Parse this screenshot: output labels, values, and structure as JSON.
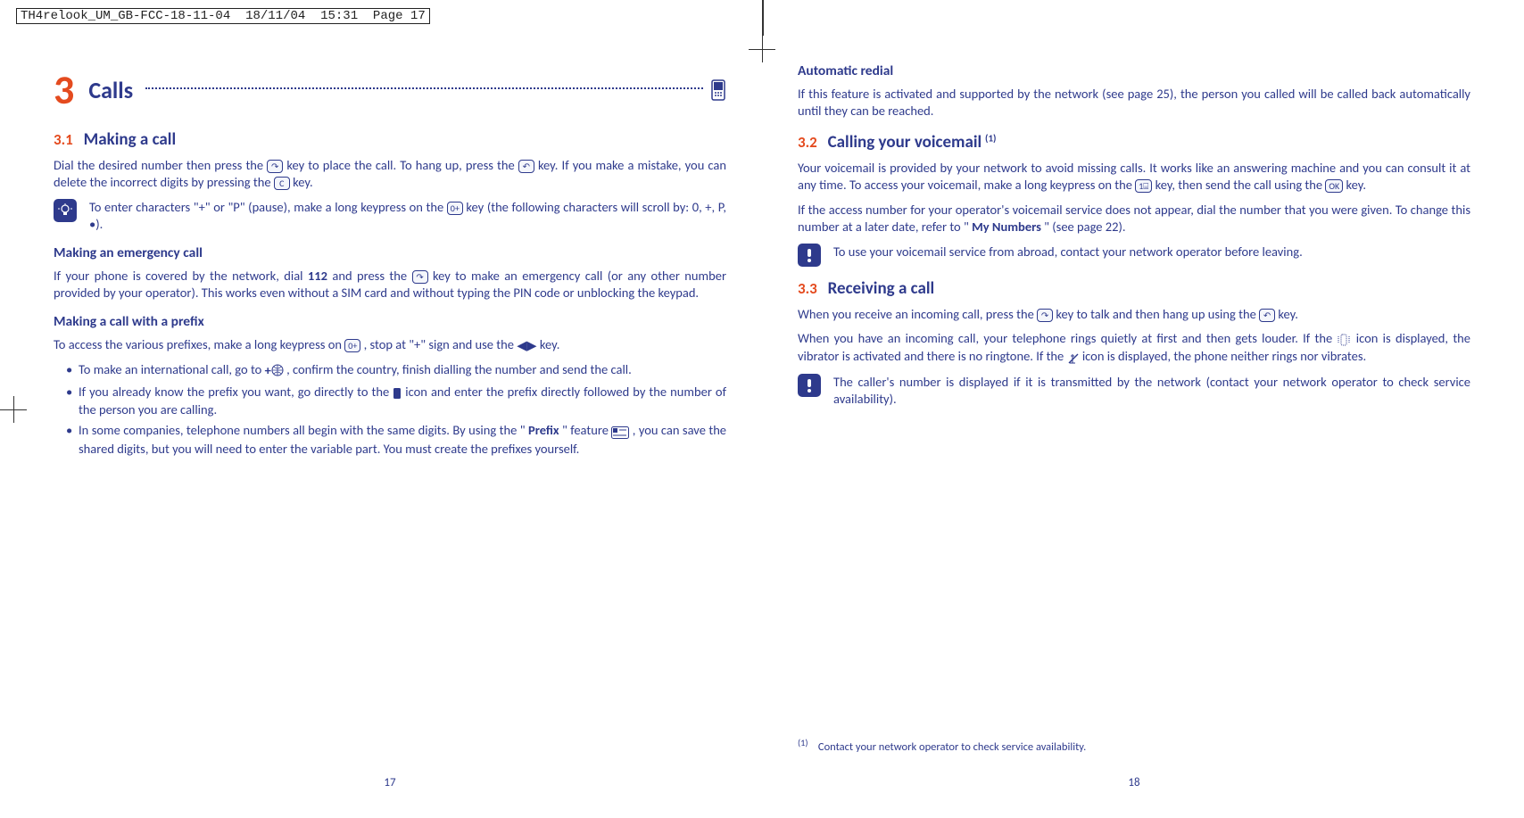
{
  "print_header": {
    "filename": "TH4relook_UM_GB-FCC-18-11-04",
    "date": "18/11/04",
    "time": "15:31",
    "page_label": "Page 17"
  },
  "left_page": {
    "chapter_number": "3",
    "chapter_title": "Calls",
    "page_number": "17",
    "sec31": {
      "num": "3.1",
      "title": "Making a call",
      "p1a": "Dial the desired number then press the ",
      "p1b": " key to place the call. To hang up, press the ",
      "p1c": " key. If you make a mistake, you can delete the incorrect digits by pressing the ",
      "p1d": " key.",
      "tip1a": "To enter characters \"+\" or \"P\" (pause), make a long keypress on the ",
      "tip1b": " key (the following characters will scroll by: 0, +, P, •).",
      "emergency_head": "Making an emergency call",
      "emergency_a": "If your phone is covered by the network, dial ",
      "emergency_num": "112",
      "emergency_b": " and press the ",
      "emergency_c": " key to make an emergency call (or any other number provided by your operator). This works even without a SIM card and without typing the PIN code or unblocking the keypad.",
      "prefix_head": "Making a call with a prefix",
      "prefix_p_a": "To access the various prefixes, make a long keypress on ",
      "prefix_p_b": ", stop at \"+\" sign and use the ",
      "prefix_p_c": " key.",
      "li1a": "To make an international call, go to ",
      "li1b": " , confirm the country, finish dialling the number and send the call.",
      "li2a": "If you already know the prefix you want, go directly to the ",
      "li2b": " icon and enter the prefix directly followed by the number of the person you are calling.",
      "li3a": "In some companies, telephone numbers all begin with the same digits. By using the \"",
      "li3_bold": "Prefix",
      "li3b": "\" feature ",
      "li3c": " , you can save the shared digits, but you will need to enter the variable part. You must create the prefixes yourself."
    }
  },
  "right_page": {
    "page_number": "18",
    "auto_redial_head": "Automatic redial",
    "auto_redial_body": "If this feature is activated and supported by the network (see page 25), the person you called will be called back automatically until they can be reached.",
    "sec32": {
      "num": "3.2",
      "title": "Calling your voicemail",
      "sup": "(1)",
      "p1a": "Your voicemail is provided by your network to avoid missing calls. It works like an answering machine and you can consult it at any time. To access your voicemail, make a long keypress on the ",
      "p1b": " key, then send the call using the ",
      "p1c": " key.",
      "p2a": "If the access number for your operator's voicemail service does not appear, dial the number that you were given. To change this number at a later date, refer to \"",
      "p2_bold": "My Numbers",
      "p2b": "\" (see page 22).",
      "warn": "To use your voicemail service from abroad, contact your network operator before leaving."
    },
    "sec33": {
      "num": "3.3",
      "title": "Receiving a call",
      "p1a": "When you receive an incoming call, press the ",
      "p1b": " key to talk and then hang up using the ",
      "p1c": " key.",
      "p2a": "When you have an incoming call, your telephone rings quietly at first and then gets louder. If the ",
      "p2b": " icon is displayed, the vibrator is activated and there is no ringtone. If the ",
      "p2c": " icon is displayed, the phone neither rings nor vibrates.",
      "warn": "The caller's number is displayed if it is transmitted by the network (contact your network operator to check service availability)."
    },
    "footnote_mark": "(1)",
    "footnote_text": "Contact your network operator to check service availability."
  }
}
